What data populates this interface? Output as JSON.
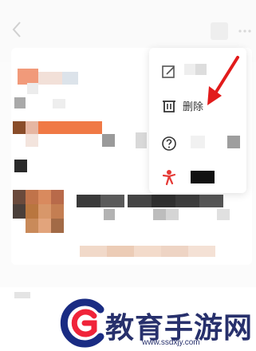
{
  "menu": {
    "items": [
      {
        "label": "",
        "icon": "edit-icon"
      },
      {
        "label": "删除",
        "icon": "trash-icon"
      },
      {
        "label": "",
        "icon": "help-icon"
      },
      {
        "label": "",
        "icon": "user-icon"
      }
    ]
  },
  "colors": {
    "accent_red": "#e53935",
    "arrow_red": "#e21b1b",
    "watermark_blue": "#27306c",
    "brand_red": "#f0243a",
    "brand_blue": "#1a2c83"
  },
  "watermark": {
    "brand": "教育手游网",
    "url": "www.ssdxjy.com"
  }
}
